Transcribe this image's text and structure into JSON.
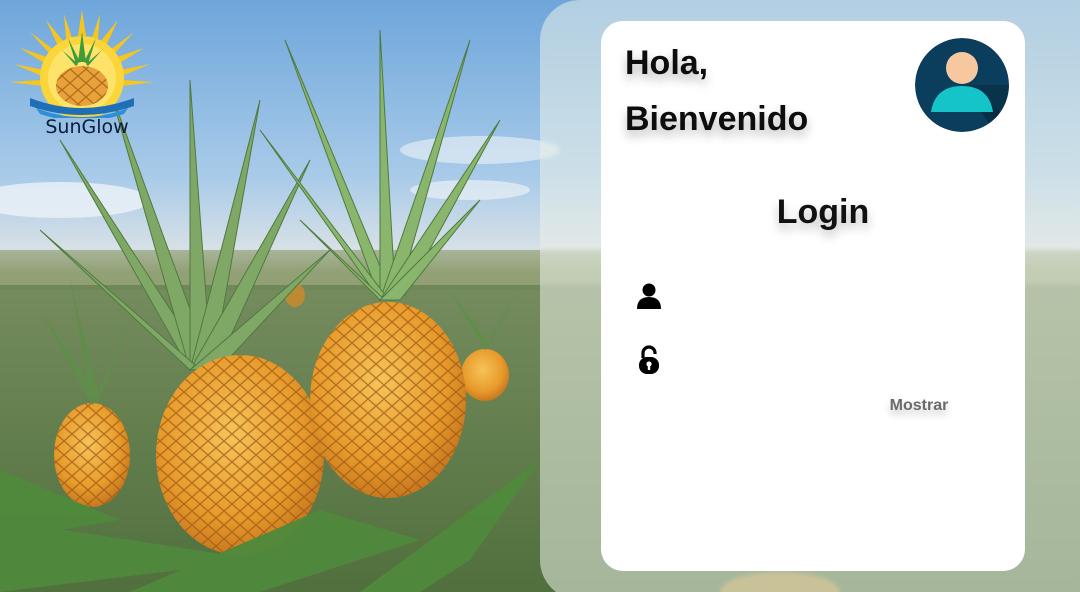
{
  "brand": {
    "name": "SunGlow",
    "logo_icon": "sun-pineapple-logo",
    "colors": {
      "sun": "#f7c51c",
      "wave": "#1e6fb5",
      "leaf": "#3f9a3a"
    }
  },
  "background": {
    "icon": "pineapple-field-image"
  },
  "card": {
    "greeting_line1": "Hola,",
    "greeting_line2": "Bienvenido",
    "avatar_icon": "user-avatar-icon",
    "title": "Login",
    "username": {
      "icon": "user-icon",
      "value": "",
      "placeholder": ""
    },
    "password": {
      "icon": "padlock-icon",
      "value": "",
      "placeholder": ""
    },
    "show_label": "Mostrar"
  },
  "colors": {
    "card_bg": "#ffffff",
    "avatar_bg": "#0b3d5c",
    "avatar_body": "#14c4c9",
    "avatar_face": "#f7c8a0",
    "text": "#111111",
    "muted": "#6b6b6b"
  }
}
